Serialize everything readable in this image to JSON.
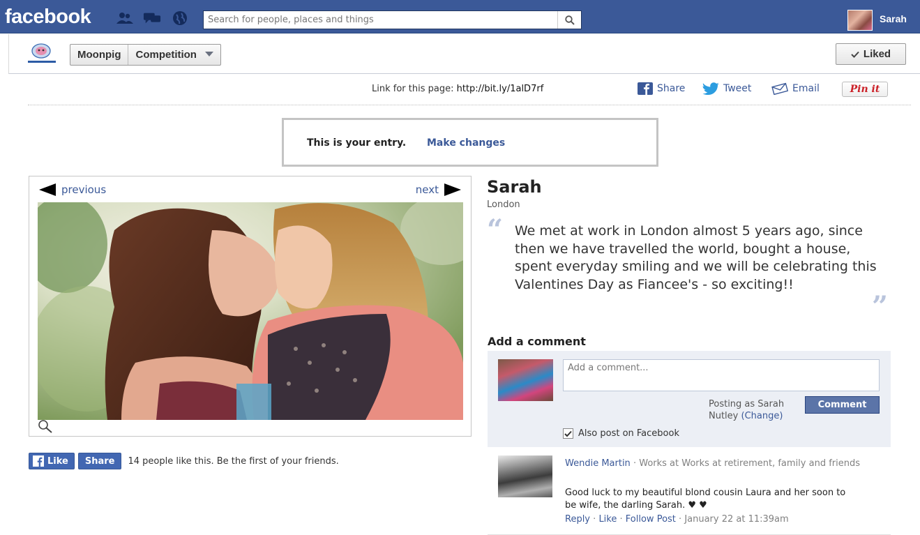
{
  "topbar": {
    "logo": "facebook",
    "search_placeholder": "Search for people, places and things",
    "user_name": "Sarah"
  },
  "app_header": {
    "app_name": "Moonpig",
    "section": "Competition",
    "liked_label": "Liked"
  },
  "share": {
    "link_label": "Link for this page:",
    "link_url": "http://bit.ly/1alD7rf",
    "share_label": "Share",
    "tweet_label": "Tweet",
    "email_label": "Email",
    "pinit_label": "Pin it"
  },
  "entry_notice": {
    "text": "This is your entry.",
    "link": "Make changes"
  },
  "gallery": {
    "prev_label": "previous",
    "next_label": "next"
  },
  "like_bar": {
    "like_label": "Like",
    "share_label": "Share",
    "text": "14 people like this. Be the first of your friends."
  },
  "entry": {
    "name": "Sarah",
    "location": "London",
    "quote": "We met at work in London almost 5 years ago, since then we have travelled the world, bought a house, spent everyday smiling and we will be celebrating this Valentines Day as Fiancee's - so exciting!!"
  },
  "comment_form": {
    "title": "Add a comment",
    "placeholder": "Add a comment...",
    "posting_as": "Posting as Sarah Nutley",
    "change_label": "(Change)",
    "submit_label": "Comment",
    "also_post_label": "Also post on Facebook",
    "also_post_checked": true
  },
  "comments": [
    {
      "author": "Wendie Martin",
      "meta": "Works at Works at retirement, family and friends",
      "body": "Good luck to my beautiful blond cousin Laura and her soon to be wife, the darling Sarah. ♥ ♥",
      "actions": [
        "Reply",
        "Like",
        "Follow Post"
      ],
      "timestamp": "January 22 at 11:39am"
    }
  ],
  "colors": {
    "facebook_blue": "#3b5998",
    "button_blue": "#5b74a8",
    "panel_gray": "#eceff5"
  }
}
